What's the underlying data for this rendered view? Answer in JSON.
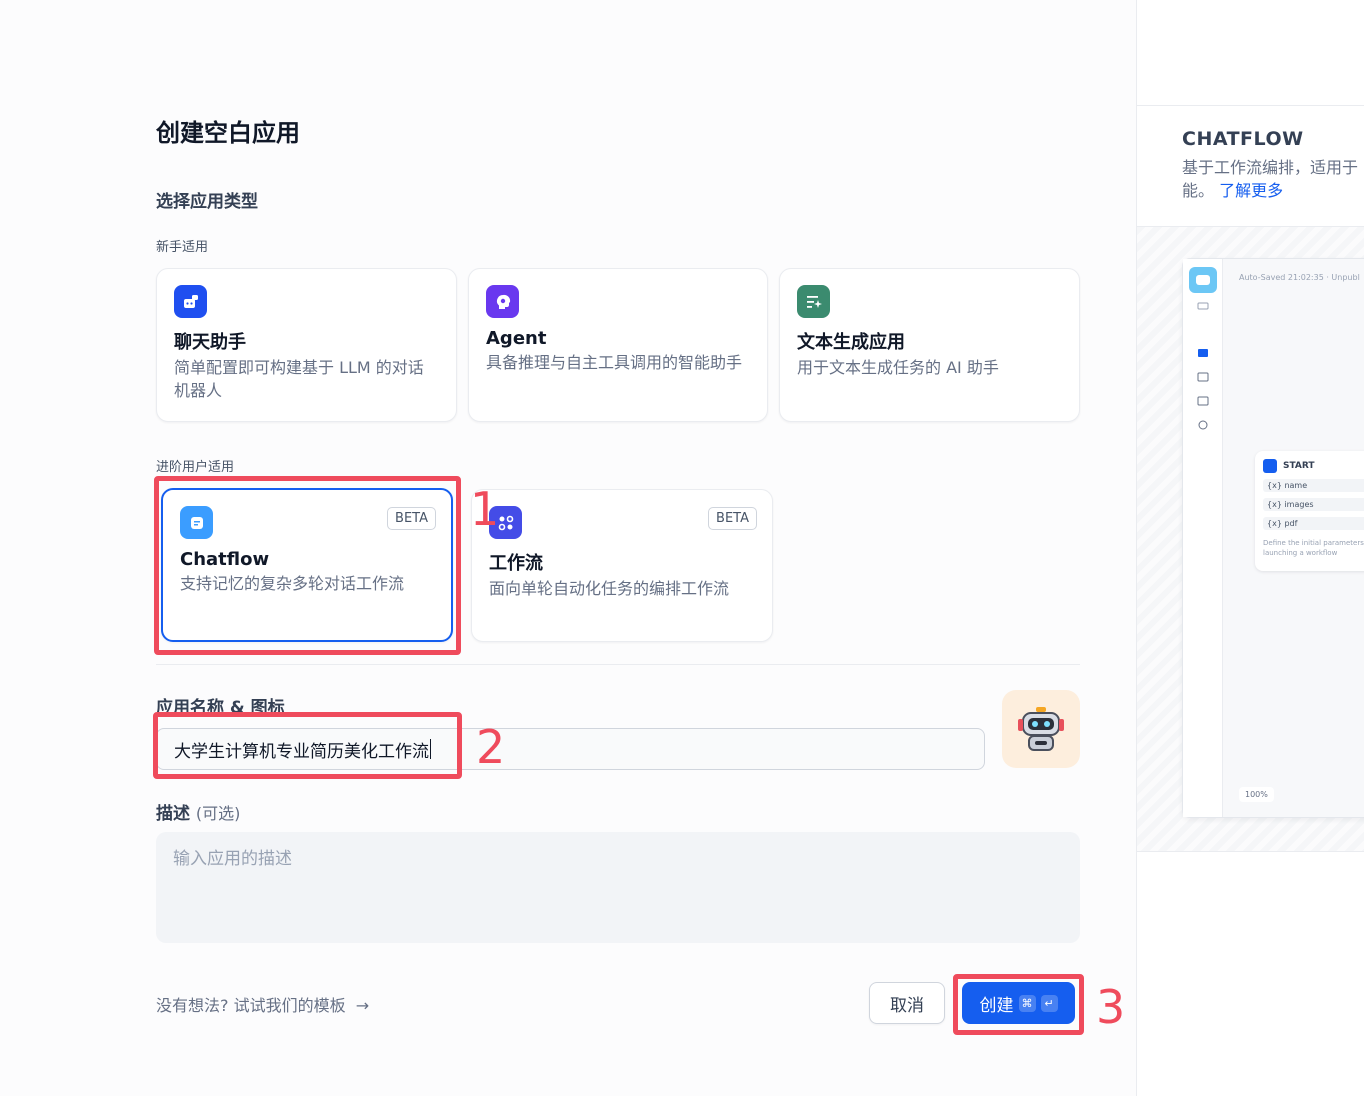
{
  "dialog": {
    "title": "创建空白应用",
    "section_title": "选择应用类型",
    "beginner_label": "新手适用",
    "advanced_label": "进阶用户适用"
  },
  "app_types": {
    "chatbot": {
      "title": "聊天助手",
      "desc": "简单配置即可构建基于 LLM 的对话机器人",
      "icon": "chatbot-icon",
      "color": "#1f4ff0"
    },
    "agent": {
      "title": "Agent",
      "desc": "具备推理与自主工具调用的智能助手",
      "icon": "agent-icon",
      "color": "#6938ef"
    },
    "completion": {
      "title": "文本生成应用",
      "desc": "用于文本生成任务的 AI 助手",
      "icon": "text-generation-icon",
      "color": "#3b8b6f"
    },
    "chatflow": {
      "title": "Chatflow",
      "desc": "支持记忆的复杂多轮对话工作流",
      "badge": "BETA",
      "icon": "chatflow-icon",
      "color": "#3b9dff"
    },
    "workflow": {
      "title": "工作流",
      "desc": "面向单轮自动化任务的编排工作流",
      "badge": "BETA",
      "icon": "workflow-icon",
      "color": "#444ce7"
    }
  },
  "form": {
    "name_label": "应用名称 & 图标",
    "name_value": "大学生计算机专业简历美化工作流",
    "desc_label": "描述",
    "desc_optional": "(可选)",
    "desc_placeholder": "输入应用的描述",
    "app_icon": "robot-icon"
  },
  "footer": {
    "template_link": "没有想法? 试试我们的模板",
    "cancel_label": "取消",
    "create_label": "创建",
    "shortcut_cmd": "⌘",
    "shortcut_enter": "↵"
  },
  "annotations": [
    "1",
    "2",
    "3"
  ],
  "preview": {
    "title": "CHATFLOW",
    "desc": "基于工作流编排，适用于",
    "desc2": "能。",
    "learn_more": "了解更多",
    "saved_text": "Auto-Saved 21:02:35 · Unpubl",
    "node_title": "START",
    "node_vars": [
      "{x} name",
      "{x} images",
      "{x} pdf"
    ],
    "node_foot": "Define the initial parameters for launching a workflow",
    "zoom": "100%"
  },
  "colors": {
    "primary": "#155eef",
    "highlight": "#ef4b5c"
  }
}
